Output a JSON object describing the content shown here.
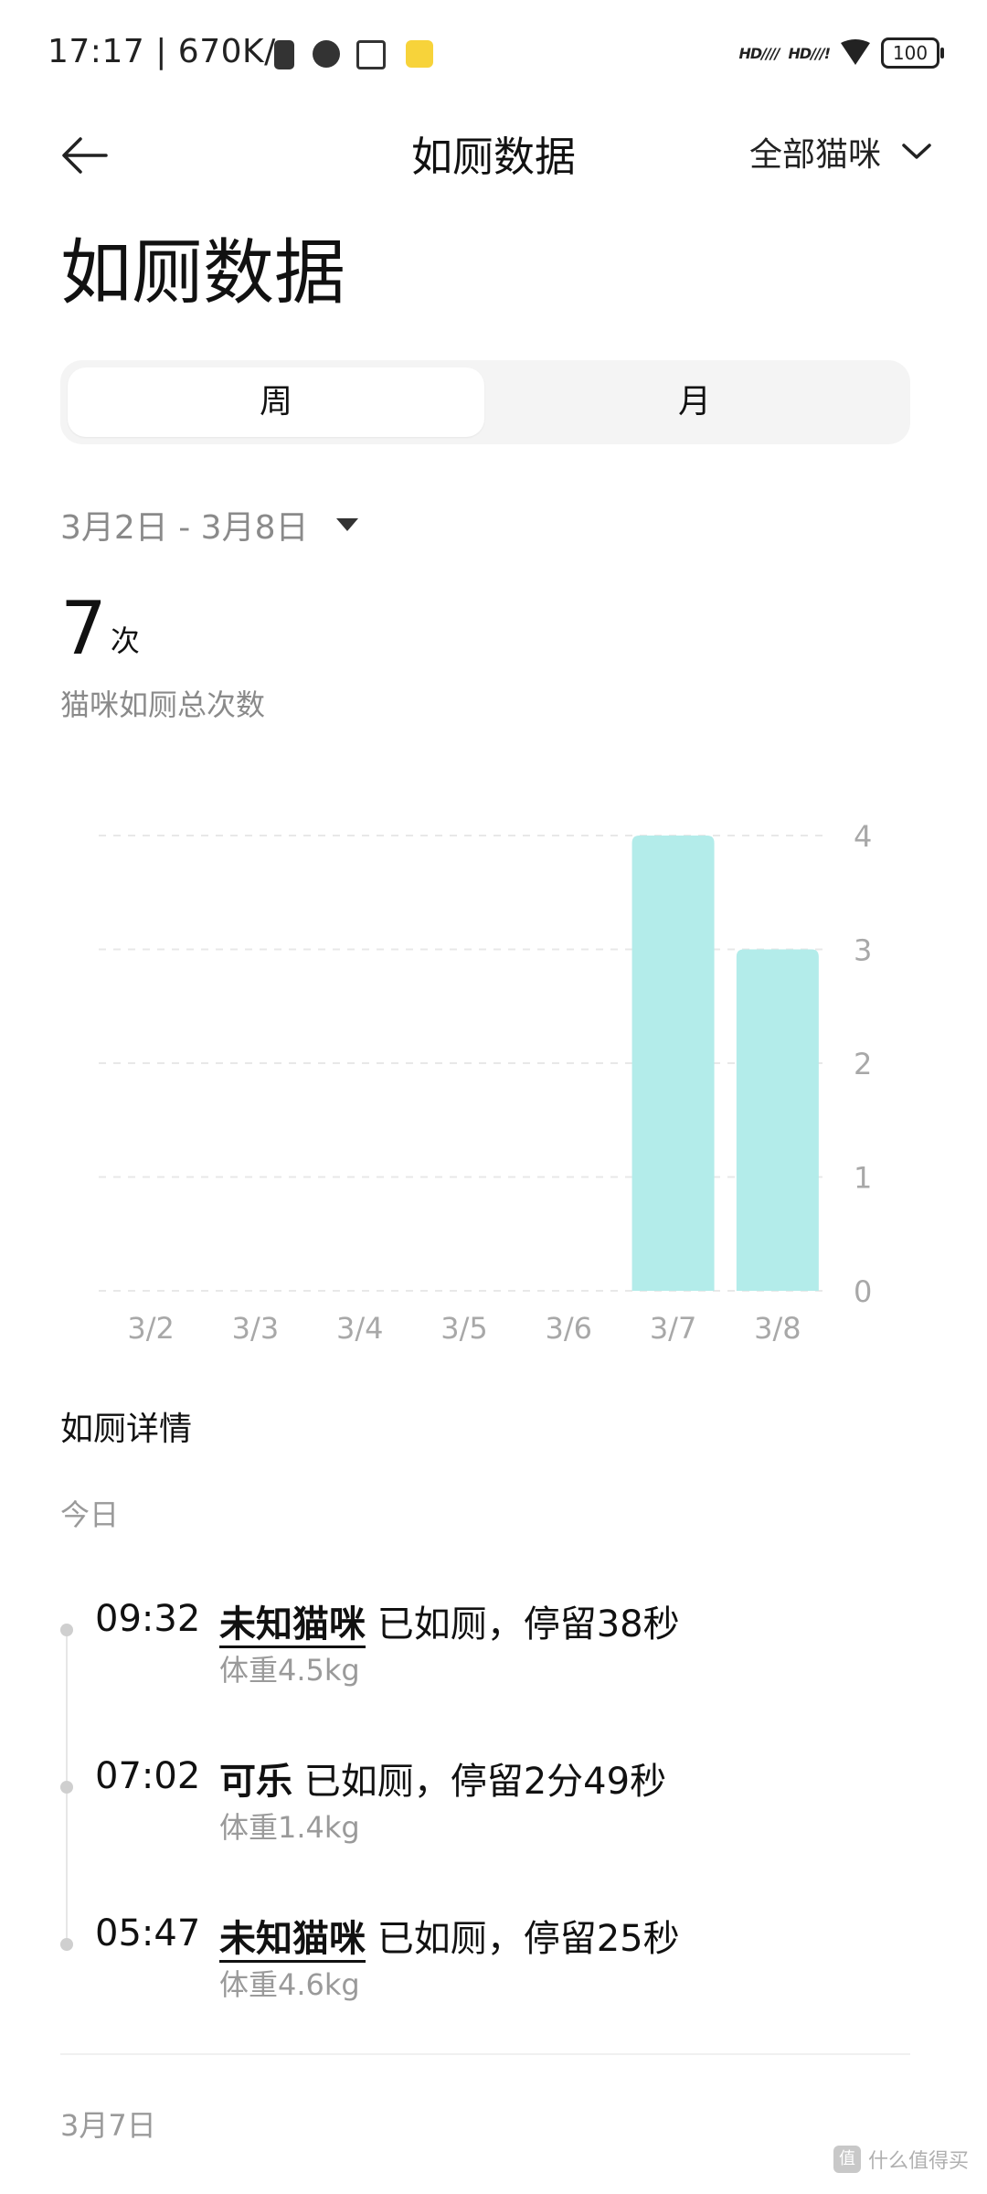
{
  "status_bar": {
    "time": "17:17",
    "net_speed": "670K/s",
    "separator": "|",
    "signal_label": "HD",
    "battery": "100"
  },
  "nav": {
    "title": "如厕数据",
    "filter_label": "全部猫咪"
  },
  "page_title": "如厕数据",
  "tabs": [
    {
      "label": "周",
      "active": true
    },
    {
      "label": "月",
      "active": false
    }
  ],
  "date_range": "3月2日 - 3月8日",
  "summary": {
    "count": "7",
    "unit": "次",
    "label": "猫咪如厕总次数"
  },
  "chart_data": {
    "type": "bar",
    "categories": [
      "3/2",
      "3/3",
      "3/4",
      "3/5",
      "3/6",
      "3/7",
      "3/8"
    ],
    "values": [
      0,
      0,
      0,
      0,
      0,
      4,
      3
    ],
    "yticks": [
      "4",
      "3",
      "2",
      "1",
      "0"
    ],
    "ylim": [
      0,
      4
    ],
    "bar_color": "#b3ecea",
    "grid": true,
    "y_axis_side": "right"
  },
  "details": {
    "title": "如厕详情",
    "day_today": "今日",
    "entries": [
      {
        "time": "09:32",
        "name": "未知猫咪",
        "action": "已如厕，停留38秒",
        "weight": "体重4.5kg"
      },
      {
        "time": "07:02",
        "name": "可乐",
        "action": "已如厕，停留2分49秒",
        "weight": "体重1.4kg"
      },
      {
        "time": "05:47",
        "name": "未知猫咪",
        "action": "已如厕，停留25秒",
        "weight": "体重4.6kg"
      }
    ],
    "day_prev": "3月7日"
  },
  "watermark": "什么值得买"
}
